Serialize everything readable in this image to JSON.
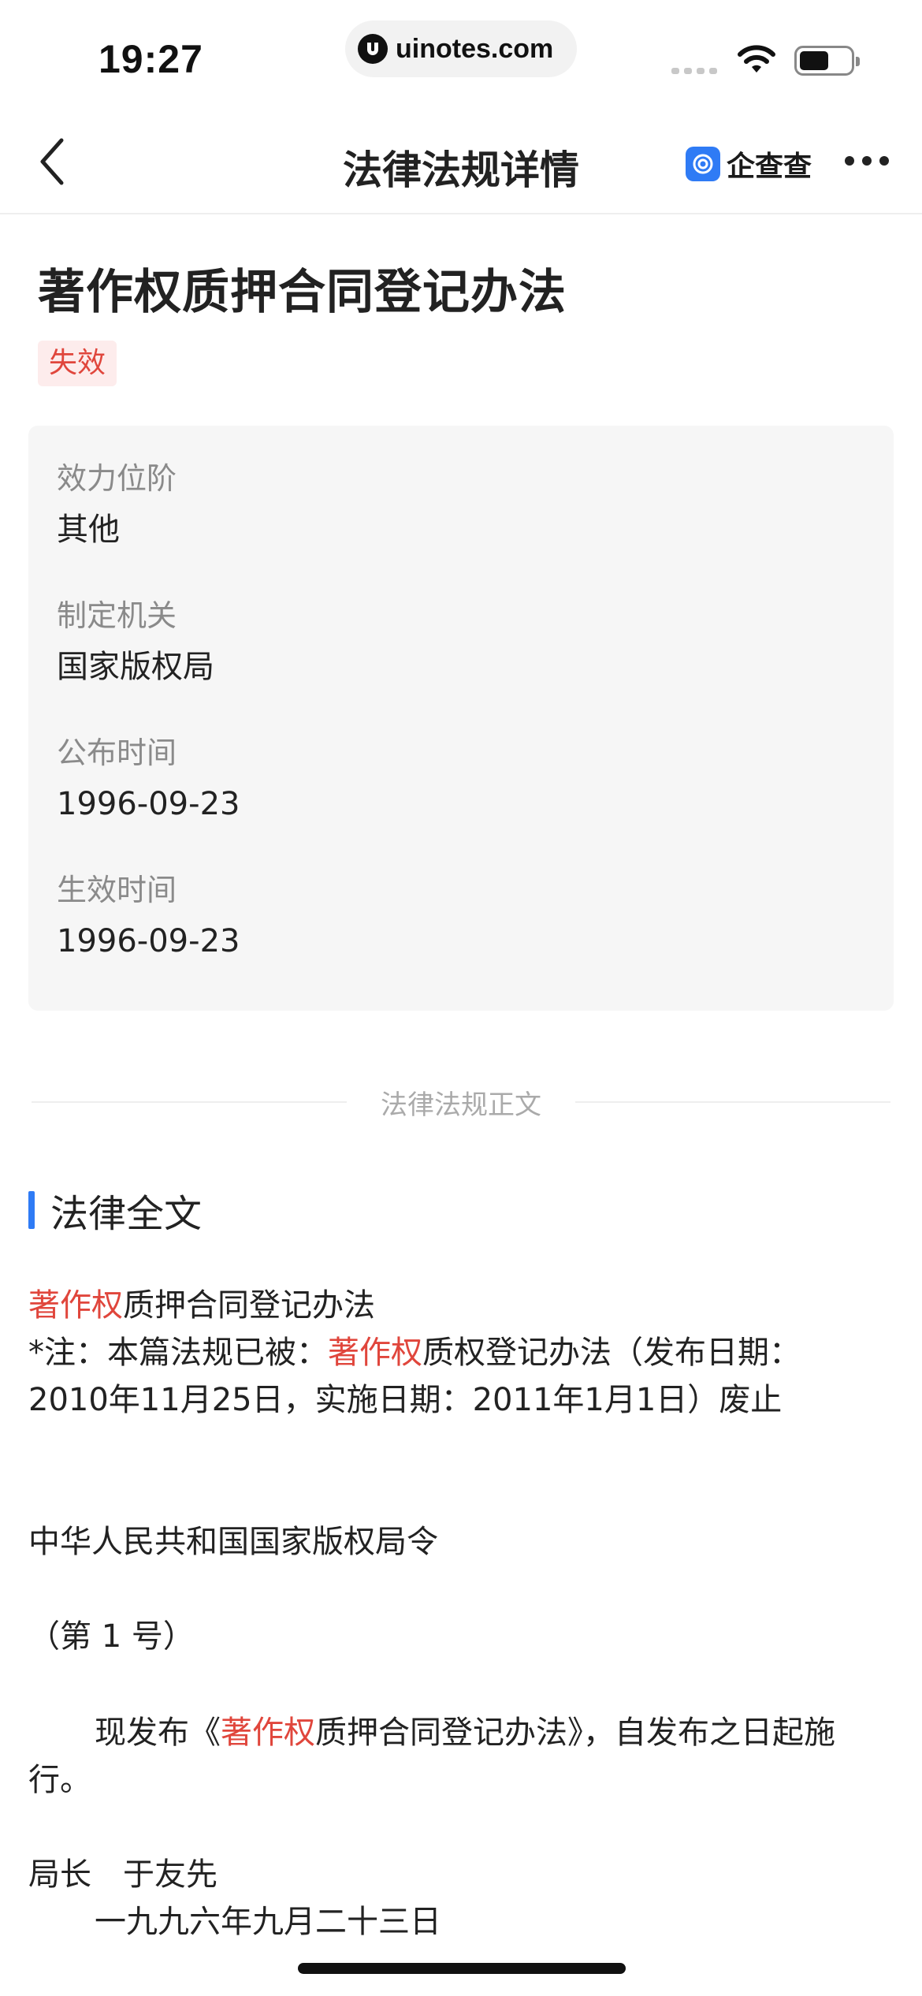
{
  "status_bar": {
    "time": "19:27",
    "url": "uinotes.com"
  },
  "nav": {
    "title": "法律法规详情",
    "brand": "企查查",
    "back_icon": "chevron-left-icon",
    "more_icon": "ellipsis-icon"
  },
  "document": {
    "title": "著作权质押合同登记办法",
    "status": "失效"
  },
  "info": [
    {
      "label": "效力位阶",
      "value": "其他"
    },
    {
      "label": "制定机关",
      "value": "国家版权局"
    },
    {
      "label": "公布时间",
      "value": "1996-09-23"
    },
    {
      "label": "生效时间",
      "value": "1996-09-23"
    }
  ],
  "divider_text": "法律法规正文",
  "section_title": "法律全文",
  "body": {
    "line1_hl": "著作权",
    "line1_rest": "质押合同登记办法",
    "note_prefix": "*注：本篇法规已被：",
    "note_hl": "著作权",
    "note_rest_1": "质权登记办法（发布日期：",
    "note_rest_2": "2010年11月25日，实施日期：2011年1月1日）废止",
    "decree": "中华人民共和国国家版权局令",
    "number": "（第 1 号）",
    "publish_prefix": "现发布《",
    "publish_hl": "著作权",
    "publish_rest_1": "质押合同登记办法》，自发布之日起施",
    "publish_rest_2": "行。",
    "director": "局长　于友先",
    "date": "一九九六年九月二十三日"
  },
  "colors": {
    "accent": "#2f7bf5",
    "highlight": "#e0463c",
    "badge_bg": "#fdecec",
    "card_bg": "#f6f6f6"
  }
}
